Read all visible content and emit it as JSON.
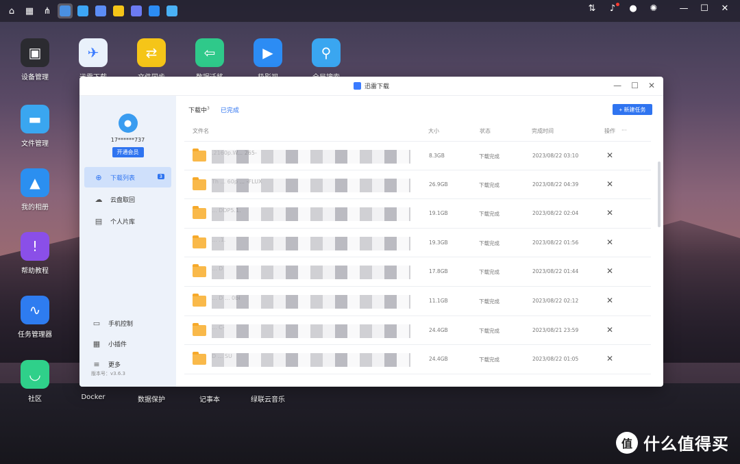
{
  "colors": {
    "accent": "#2f74f0",
    "folder": "#f9b94a"
  },
  "topbar": {
    "left_icons": [
      "home-icon",
      "grid-icon",
      "network-icon",
      "thunder-app-icon",
      "mail-icon",
      "printer-icon",
      "sync-icon",
      "photos-icon",
      "tv-icon",
      "note-icon"
    ],
    "right_icons": [
      "analytics-icon",
      "bell-icon",
      "user-icon",
      "settings-icon",
      "minimize-icon",
      "maximize-icon",
      "close-icon"
    ]
  },
  "desktop": {
    "col1": [
      "设备管理",
      "文件管理",
      "我的相册",
      "帮助教程",
      "任务管理器",
      "社区"
    ],
    "row1": [
      "迅雷下载",
      "文件同步",
      "数据迁移",
      "极影视",
      "全局搜索"
    ],
    "bottom": [
      "Docker",
      "数据保护",
      "记事本",
      "绿联云音乐"
    ]
  },
  "window": {
    "title": "迅雷下载",
    "user_id": "17******737",
    "vip_button": "开通会员",
    "nav": [
      {
        "label": "下载列表",
        "badge": "3"
      },
      {
        "label": "云盘取回"
      },
      {
        "label": "个人片库"
      }
    ],
    "bottom_nav": [
      "手机控制",
      "小插件",
      "更多"
    ],
    "version": "版本号：v3.6.3",
    "tabs": {
      "downloading": "下载中",
      "downloading_count": "3",
      "completed": "已完成"
    },
    "new_task_button": "+ 新建任务",
    "columns": {
      "name": "文件名",
      "size": "大小",
      "status": "状态",
      "time": "完成时间",
      "action": "操作",
      "more": "···"
    },
    "rows": [
      {
        "name": ".2160p.W... 265-",
        "size": "8.3GB",
        "status": "下载完成",
        "time": "2023/08/22 03:10"
      },
      {
        "name": "Th ... 60p ... -FLUX",
        "size": "26.9GB",
        "status": "下载完成",
        "time": "2023/08/22 04:39"
      },
      {
        "name": "... DDP5.1.",
        "size": "19.1GB",
        "status": "下载完成",
        "time": "2023/08/22 02:04"
      },
      {
        "name": "... .1.",
        "size": "19.3GB",
        "status": "下载完成",
        "time": "2023/08/22 01:56"
      },
      {
        "name": "... D",
        "size": "17.8GB",
        "status": "下载完成",
        "time": "2023/08/22 01:44"
      },
      {
        "name": "... D ... 0bi",
        "size": "11.1GB",
        "status": "下载完成",
        "time": "2023/08/22 02:12"
      },
      {
        "name": "... C-",
        "size": "24.4GB",
        "status": "下载完成",
        "time": "2023/08/21 23:59"
      },
      {
        "name": "D ... SU",
        "size": "24.4GB",
        "status": "下载完成",
        "time": "2023/08/22 01:05"
      }
    ]
  },
  "watermark": {
    "logo": "值",
    "text": "什么值得买"
  }
}
